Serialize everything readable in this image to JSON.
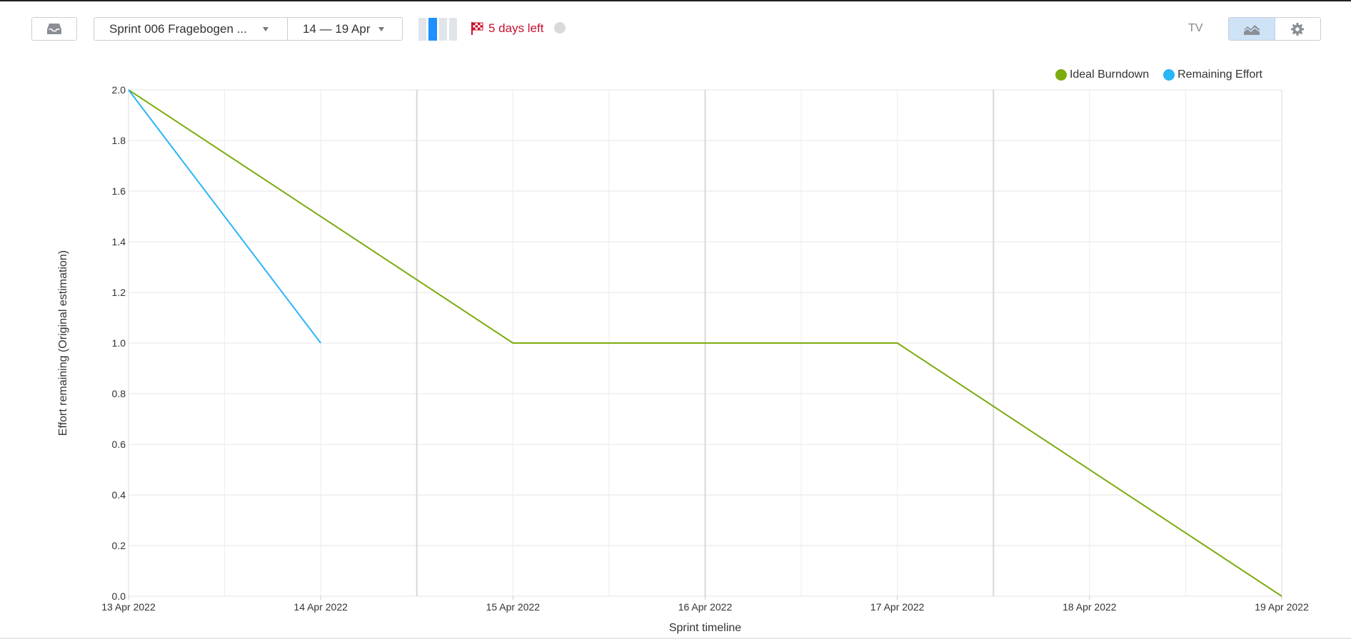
{
  "toolbar": {
    "sprint_label": "Sprint 006 Fragebogen ...",
    "date_range_label": "14 — 19 Apr",
    "days_left_label": "5 days left",
    "tv_label": "TV",
    "sprint_progress": {
      "segments_total": 4,
      "segments_done": 1
    }
  },
  "icons": {
    "inbox": "inbox-icon",
    "flag": "checkered-flag-icon",
    "chart_view": "area-chart-icon",
    "settings": "gear-icon"
  },
  "colors": {
    "ideal": "#7cab0e",
    "remaining": "#29b6f6",
    "accent": "#1e90ff",
    "days_left": "#c8102e"
  },
  "chart_data": {
    "type": "line",
    "xlabel": "Sprint timeline",
    "ylabel": "Effort remaining (Original estimation)",
    "x_ticks": [
      "13 Apr 2022",
      "14 Apr 2022",
      "15 Apr 2022",
      "16 Apr 2022",
      "17 Apr 2022",
      "18 Apr 2022",
      "19 Apr 2022"
    ],
    "y_ticks": [
      "0.0",
      "0.2",
      "0.4",
      "0.6",
      "0.8",
      "1.0",
      "1.2",
      "1.4",
      "1.6",
      "1.8",
      "2.0"
    ],
    "xlim": [
      "2022-04-13",
      "2022-04-19"
    ],
    "ylim": [
      0,
      2
    ],
    "grid": true,
    "legend_position": "top-right",
    "series": [
      {
        "name": "Ideal Burndown",
        "color": "#7cab0e",
        "x": [
          "2022-04-13",
          "2022-04-15",
          "2022-04-17",
          "2022-04-19"
        ],
        "y": [
          2.0,
          1.0,
          1.0,
          0.0
        ]
      },
      {
        "name": "Remaining Effort",
        "color": "#29b6f6",
        "x": [
          "2022-04-13",
          "2022-04-14"
        ],
        "y": [
          2.0,
          1.0
        ]
      }
    ]
  }
}
